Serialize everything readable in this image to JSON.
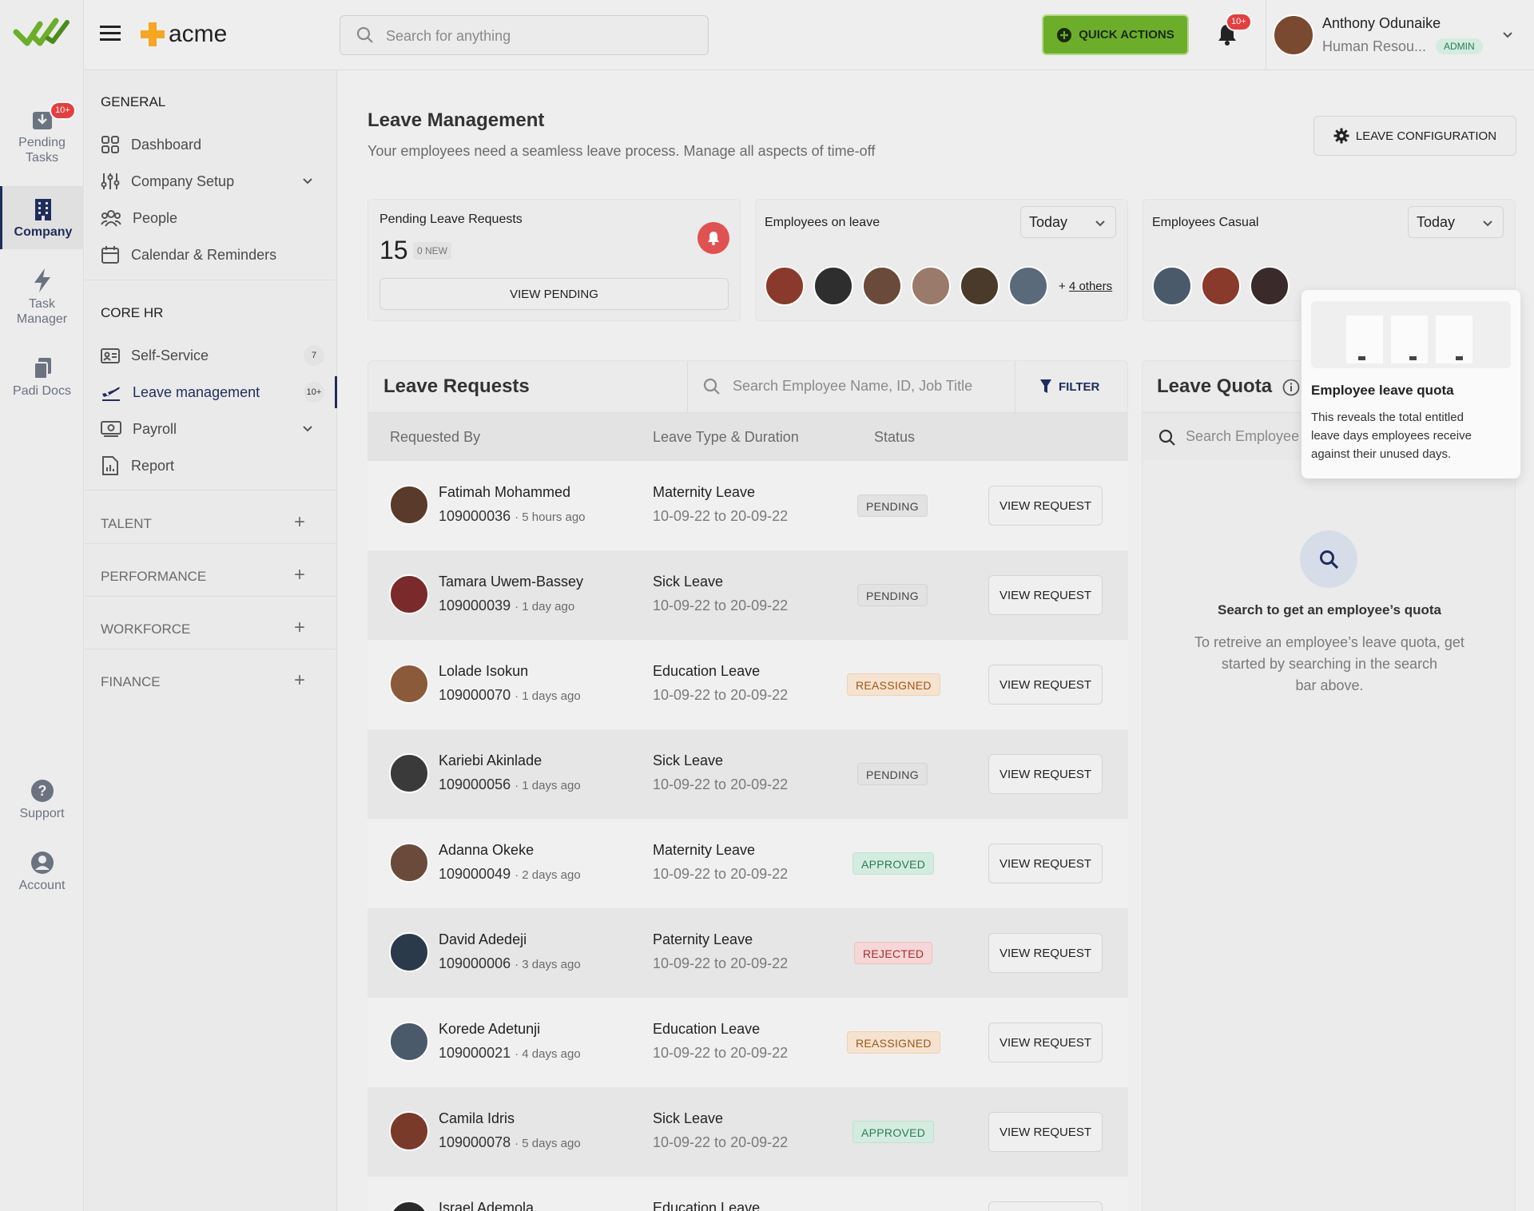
{
  "brand": {
    "name": "acme",
    "accent": "#f5a623"
  },
  "search": {
    "placeholder": "Search for anything"
  },
  "header": {
    "quick_actions": "QUICK ACTIONS",
    "notif_badge": "10+"
  },
  "user": {
    "name": "Anthony Odunaike",
    "role": "Human Resou...",
    "badge": "ADMIN"
  },
  "rail": {
    "pending": {
      "label1": "Pending",
      "label2": "Tasks",
      "badge": "10+"
    },
    "company": "Company",
    "task": {
      "label1": "Task",
      "label2": "Manager"
    },
    "docs": "Padi Docs",
    "support": "Support",
    "account": "Account"
  },
  "nav": {
    "general": "GENERAL",
    "general_items": [
      {
        "label": "Dashboard",
        "icon": "grid-icon"
      },
      {
        "label": "Company Setup",
        "icon": "sliders-icon"
      },
      {
        "label": "People",
        "icon": "people-icon"
      },
      {
        "label": "Calendar & Reminders",
        "icon": "calendar-icon"
      }
    ],
    "core": "CORE HR",
    "core_items": [
      {
        "label": "Self-Service",
        "count": "7",
        "icon": "id-card-icon"
      },
      {
        "label": "Leave management",
        "count": "10+",
        "icon": "plane-icon"
      },
      {
        "label": "Payroll",
        "icon": "money-icon"
      },
      {
        "label": "Report",
        "icon": "report-icon"
      }
    ],
    "sections": [
      "TALENT",
      "PERFORMANCE",
      "WORKFORCE",
      "FINANCE"
    ]
  },
  "page": {
    "title": "Leave Management",
    "subtitle": "Your employees need a seamless leave process. Manage all aspects of time-off",
    "config_button": "LEAVE CONFIGURATION"
  },
  "stats": {
    "pending": {
      "title": "Pending Leave Requests",
      "count": "15",
      "new": "0 NEW",
      "button": "VIEW PENDING"
    },
    "on_leave": {
      "title": "Employees on leave",
      "select": "Today",
      "others": "4 others",
      "plus": "+"
    },
    "casual": {
      "title": "Employees Casual",
      "select": "Today"
    }
  },
  "requests": {
    "title": "Leave Requests",
    "search_placeholder": "Search Employee Name, ID, Job Title",
    "filter": "FILTER",
    "columns": [
      "Requested By",
      "Leave Type & Duration",
      "Status"
    ],
    "view_label": "VIEW REQUEST",
    "rows": [
      {
        "name": "Fatimah Mohammed",
        "id": "109000036",
        "ago": "5 hours ago",
        "type": "Maternity Leave",
        "dates": "10-09-22 to 20-09-22",
        "status": "PENDING",
        "avatar_color": "#5a3a2a"
      },
      {
        "name": "Tamara Uwem-Bassey",
        "id": "109000039",
        "ago": "1 day ago",
        "type": "Sick Leave",
        "dates": "10-09-22 to 20-09-22",
        "status": "PENDING",
        "avatar_color": "#7a2a2a"
      },
      {
        "name": "Lolade Isokun",
        "id": "109000070",
        "ago": "1 days ago",
        "type": "Education Leave",
        "dates": "10-09-22 to 20-09-22",
        "status": "REASSIGNED",
        "avatar_color": "#8a5a3a"
      },
      {
        "name": "Kariebi Akinlade",
        "id": "109000056",
        "ago": "1 days ago",
        "type": "Sick Leave",
        "dates": "10-09-22 to 20-09-22",
        "status": "PENDING",
        "avatar_color": "#3a3a3a"
      },
      {
        "name": "Adanna Okeke",
        "id": "109000049",
        "ago": "2 days ago",
        "type": "Maternity Leave",
        "dates": "10-09-22 to 20-09-22",
        "status": "APPROVED",
        "avatar_color": "#6a4a3a"
      },
      {
        "name": "David Adedeji",
        "id": "109000006",
        "ago": "3 days ago",
        "type": "Paternity Leave",
        "dates": "10-09-22 to 20-09-22",
        "status": "REJECTED",
        "avatar_color": "#2a3a4a"
      },
      {
        "name": "Korede Adetunji",
        "id": "109000021",
        "ago": "4 days ago",
        "type": "Education Leave",
        "dates": "10-09-22 to 20-09-22",
        "status": "REASSIGNED",
        "avatar_color": "#4a5a6a"
      },
      {
        "name": "Camila Idris",
        "id": "109000078",
        "ago": "5 days ago",
        "type": "Sick Leave",
        "dates": "10-09-22 to 20-09-22",
        "status": "APPROVED",
        "avatar_color": "#7a3a2a"
      },
      {
        "name": "Israel Ademola",
        "id": "",
        "ago": "",
        "type": "Education Leave",
        "dates": "",
        "status": "",
        "avatar_color": "#2a2a2a"
      }
    ]
  },
  "quota": {
    "title": "Leave Quota",
    "search_placeholder": "Search Employee",
    "empty_title": "Search to get an employee’s quota",
    "empty_line1": "To retreive an employee’s leave quota, get",
    "empty_line2": "started by searching in the search",
    "empty_line3": "bar above.",
    "tooltip_title": "Employee leave quota",
    "tooltip_line1": "This reveals the total entitled",
    "tooltip_line2": "leave days employees receive",
    "tooltip_line3": "against their unused days."
  },
  "colors": {
    "navy": "#1f2d5c",
    "green": "#6cae2a",
    "red": "#e53e3e"
  }
}
